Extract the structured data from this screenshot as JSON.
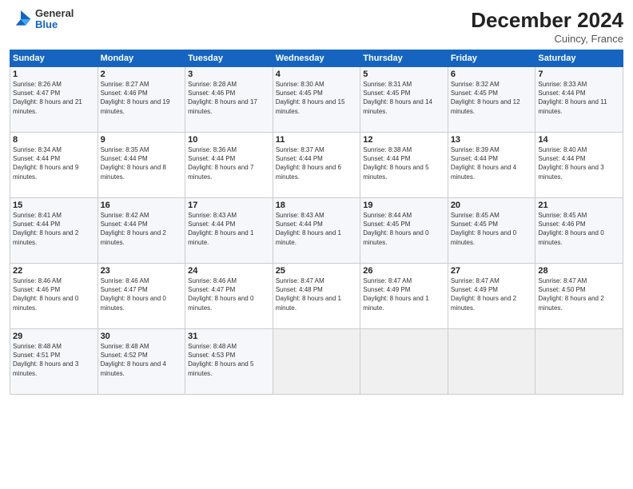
{
  "header": {
    "logo_general": "General",
    "logo_blue": "Blue",
    "month_year": "December 2024",
    "location": "Cuincy, France"
  },
  "days_of_week": [
    "Sunday",
    "Monday",
    "Tuesday",
    "Wednesday",
    "Thursday",
    "Friday",
    "Saturday"
  ],
  "weeks": [
    [
      {
        "day": "1",
        "sunrise": "8:26 AM",
        "sunset": "4:47 PM",
        "daylight": "8 hours and 21 minutes."
      },
      {
        "day": "2",
        "sunrise": "8:27 AM",
        "sunset": "4:46 PM",
        "daylight": "8 hours and 19 minutes."
      },
      {
        "day": "3",
        "sunrise": "8:28 AM",
        "sunset": "4:46 PM",
        "daylight": "8 hours and 17 minutes."
      },
      {
        "day": "4",
        "sunrise": "8:30 AM",
        "sunset": "4:45 PM",
        "daylight": "8 hours and 15 minutes."
      },
      {
        "day": "5",
        "sunrise": "8:31 AM",
        "sunset": "4:45 PM",
        "daylight": "8 hours and 14 minutes."
      },
      {
        "day": "6",
        "sunrise": "8:32 AM",
        "sunset": "4:45 PM",
        "daylight": "8 hours and 12 minutes."
      },
      {
        "day": "7",
        "sunrise": "8:33 AM",
        "sunset": "4:44 PM",
        "daylight": "8 hours and 11 minutes."
      }
    ],
    [
      {
        "day": "8",
        "sunrise": "8:34 AM",
        "sunset": "4:44 PM",
        "daylight": "8 hours and 9 minutes."
      },
      {
        "day": "9",
        "sunrise": "8:35 AM",
        "sunset": "4:44 PM",
        "daylight": "8 hours and 8 minutes."
      },
      {
        "day": "10",
        "sunrise": "8:36 AM",
        "sunset": "4:44 PM",
        "daylight": "8 hours and 7 minutes."
      },
      {
        "day": "11",
        "sunrise": "8:37 AM",
        "sunset": "4:44 PM",
        "daylight": "8 hours and 6 minutes."
      },
      {
        "day": "12",
        "sunrise": "8:38 AM",
        "sunset": "4:44 PM",
        "daylight": "8 hours and 5 minutes."
      },
      {
        "day": "13",
        "sunrise": "8:39 AM",
        "sunset": "4:44 PM",
        "daylight": "8 hours and 4 minutes."
      },
      {
        "day": "14",
        "sunrise": "8:40 AM",
        "sunset": "4:44 PM",
        "daylight": "8 hours and 3 minutes."
      }
    ],
    [
      {
        "day": "15",
        "sunrise": "8:41 AM",
        "sunset": "4:44 PM",
        "daylight": "8 hours and 2 minutes."
      },
      {
        "day": "16",
        "sunrise": "8:42 AM",
        "sunset": "4:44 PM",
        "daylight": "8 hours and 2 minutes."
      },
      {
        "day": "17",
        "sunrise": "8:43 AM",
        "sunset": "4:44 PM",
        "daylight": "8 hours and 1 minute."
      },
      {
        "day": "18",
        "sunrise": "8:43 AM",
        "sunset": "4:44 PM",
        "daylight": "8 hours and 1 minute."
      },
      {
        "day": "19",
        "sunrise": "8:44 AM",
        "sunset": "4:45 PM",
        "daylight": "8 hours and 0 minutes."
      },
      {
        "day": "20",
        "sunrise": "8:45 AM",
        "sunset": "4:45 PM",
        "daylight": "8 hours and 0 minutes."
      },
      {
        "day": "21",
        "sunrise": "8:45 AM",
        "sunset": "4:46 PM",
        "daylight": "8 hours and 0 minutes."
      }
    ],
    [
      {
        "day": "22",
        "sunrise": "8:46 AM",
        "sunset": "4:46 PM",
        "daylight": "8 hours and 0 minutes."
      },
      {
        "day": "23",
        "sunrise": "8:46 AM",
        "sunset": "4:47 PM",
        "daylight": "8 hours and 0 minutes."
      },
      {
        "day": "24",
        "sunrise": "8:46 AM",
        "sunset": "4:47 PM",
        "daylight": "8 hours and 0 minutes."
      },
      {
        "day": "25",
        "sunrise": "8:47 AM",
        "sunset": "4:48 PM",
        "daylight": "8 hours and 1 minute."
      },
      {
        "day": "26",
        "sunrise": "8:47 AM",
        "sunset": "4:49 PM",
        "daylight": "8 hours and 1 minute."
      },
      {
        "day": "27",
        "sunrise": "8:47 AM",
        "sunset": "4:49 PM",
        "daylight": "8 hours and 2 minutes."
      },
      {
        "day": "28",
        "sunrise": "8:47 AM",
        "sunset": "4:50 PM",
        "daylight": "8 hours and 2 minutes."
      }
    ],
    [
      {
        "day": "29",
        "sunrise": "8:48 AM",
        "sunset": "4:51 PM",
        "daylight": "8 hours and 3 minutes."
      },
      {
        "day": "30",
        "sunrise": "8:48 AM",
        "sunset": "4:52 PM",
        "daylight": "8 hours and 4 minutes."
      },
      {
        "day": "31",
        "sunrise": "8:48 AM",
        "sunset": "4:53 PM",
        "daylight": "8 hours and 5 minutes."
      },
      null,
      null,
      null,
      null
    ]
  ]
}
